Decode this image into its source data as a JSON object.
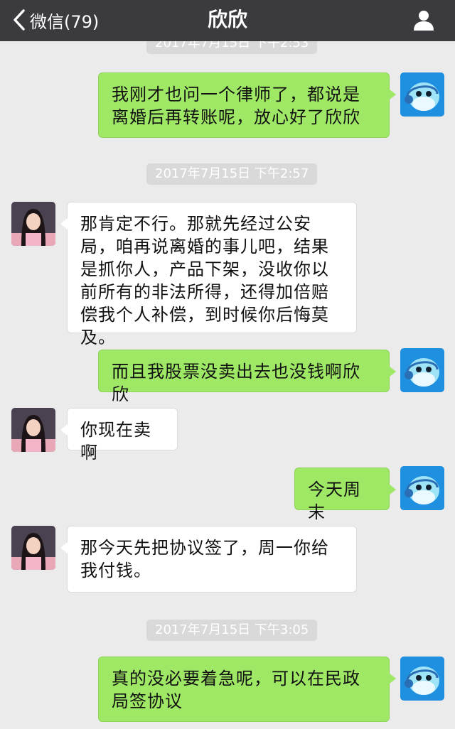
{
  "nav": {
    "back_label": "微信(79)",
    "title": "欣欣"
  },
  "messages": {
    "ts0": "2017年7月15日 下午2:53",
    "m1": "我刚才也问一个律师了，都说是离婚后再转账呢，放心好了欣欣",
    "ts1": "2017年7月15日 下午2:57",
    "m2": "那肯定不行。那就先经过公安局，咱再说离婚的事儿吧，结果是抓你人，产品下架，没收你以前所有的非法所得，还得加倍赔偿我个人补偿，到时候你后悔莫及。",
    "m3": "而且我股票没卖出去也没钱啊欣欣",
    "m4": "你现在卖啊",
    "m5": "今天周末",
    "m6": "那今天先把协议签了，周一你给我付钱。",
    "ts2": "2017年7月15日 下午3:05",
    "m7": "真的没必要着急呢，可以在民政局签协议"
  },
  "colors": {
    "nav_bg": "#3a3a3f",
    "chat_bg": "#ebebeb",
    "outgoing_bubble": "#9fe866",
    "incoming_bubble": "#ffffff",
    "timestamp_bg": "#d9d9d9"
  },
  "icons": {
    "back": "chevron-left-icon",
    "profile": "person-icon",
    "self_avatar": "blue-cartoon-avatar",
    "contact_avatar": "girl-photo-avatar"
  }
}
